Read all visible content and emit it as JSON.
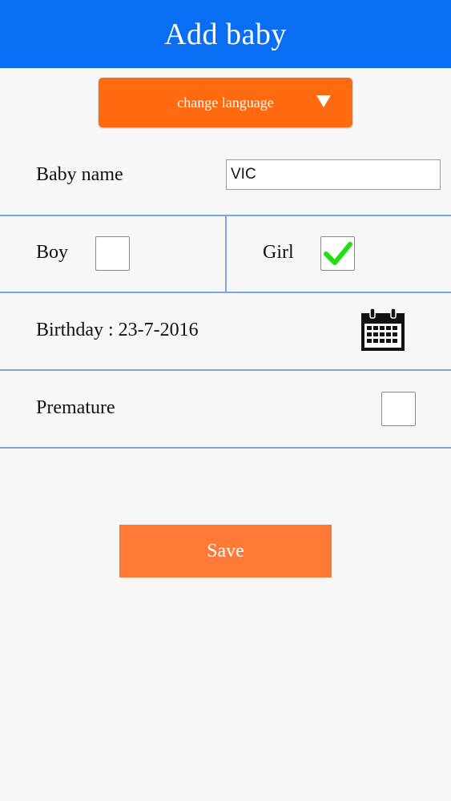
{
  "header": {
    "title": "Add baby"
  },
  "language": {
    "label": "change language",
    "dropdown_icon": "triangle-down-icon"
  },
  "form": {
    "baby_name_label": "Baby name",
    "baby_name_value": "VIC",
    "boy_label": "Boy",
    "boy_checked": false,
    "girl_label": "Girl",
    "girl_checked": true,
    "birthday_label": "Birthday : 23-7-2016",
    "calendar_icon": "calendar-icon",
    "premature_label": "Premature",
    "premature_checked": false
  },
  "actions": {
    "save_label": "Save"
  },
  "colors": {
    "header_bg": "#0a6ef5",
    "language_button_bg": "#ff6a10",
    "save_button_bg": "#ff7a36",
    "divider": "#7aa8dc",
    "check_mark": "#22dd11"
  }
}
